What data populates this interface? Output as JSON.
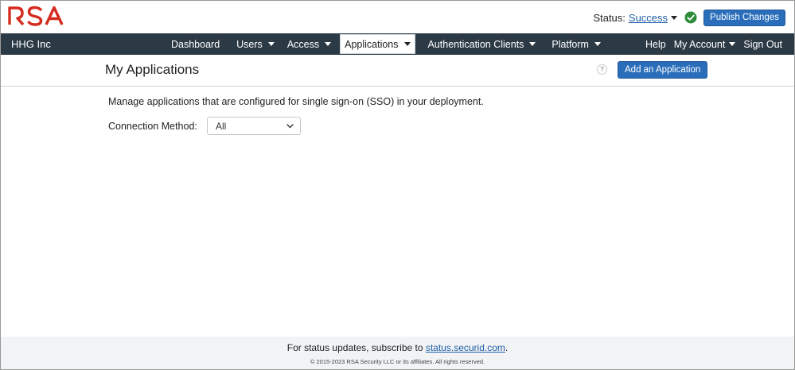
{
  "header": {
    "logo_text": "RSA",
    "status_label": "Status:",
    "status_value": "Success",
    "publish_label": "Publish Changes",
    "status_color": "#2e8b3a"
  },
  "nav": {
    "org_name": "HHG Inc",
    "items": [
      {
        "label": "Dashboard",
        "dropdown": false
      },
      {
        "label": "Users",
        "dropdown": true
      },
      {
        "label": "Access",
        "dropdown": true
      },
      {
        "label": "Applications",
        "dropdown": true,
        "active": true
      },
      {
        "label": "Authentication Clients",
        "dropdown": true
      },
      {
        "label": "Platform",
        "dropdown": true
      }
    ],
    "right_items": [
      {
        "label": "Help",
        "dropdown": false
      },
      {
        "label": "My Account",
        "dropdown": true
      },
      {
        "label": "Sign Out",
        "dropdown": false
      }
    ]
  },
  "page": {
    "title": "My Applications",
    "help_glyph": "?",
    "add_button": "Add an Application",
    "description": "Manage applications that are configured for single sign-on (SSO) in your deployment.",
    "filter_label": "Connection Method:",
    "filter_value": "All"
  },
  "footer": {
    "status_prefix": "For status updates, subscribe to ",
    "status_link": "status.securid.com",
    "status_suffix": ".",
    "copyright": "© 2015-2023 RSA Security LLC or its affiliates. All rights reserved."
  },
  "colors": {
    "navbar_bg": "#2c3a46",
    "brand_red": "#d52b1e",
    "primary_button": "#2a6ebb"
  }
}
